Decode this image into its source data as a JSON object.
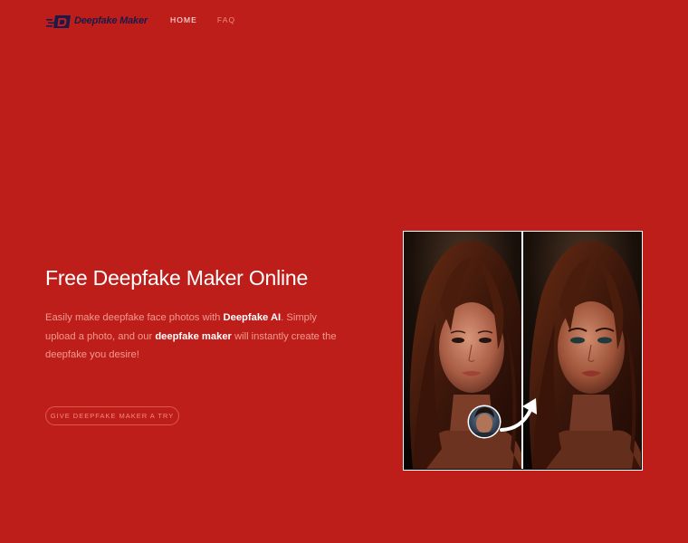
{
  "header": {
    "logo_text": "Deepfake Maker",
    "logo_icon": "deepfake-logo-icon",
    "nav": [
      {
        "label": "HOME",
        "active": true
      },
      {
        "label": "FAQ",
        "active": false
      }
    ]
  },
  "hero": {
    "title": "Free Deepfake Maker Online",
    "desc_part1": "Easily make deepfake face photos with ",
    "desc_bold1": "Deepfake AI",
    "desc_part2": ". Simply upload a photo, and our ",
    "desc_bold2": "deepfake maker",
    "desc_part3": " will instantly create the deepfake you desire!",
    "cta_label": "GIVE DEEPFAKE MAKER A TRY"
  },
  "image_panel": {
    "left_image": "original-face-photo",
    "right_image": "deepfake-result-photo",
    "source_face": "source-face-avatar",
    "arrow_icon": "curved-arrow-icon"
  },
  "colors": {
    "background": "#be1e1a",
    "logo_text": "#1c1a4a",
    "muted_text": "#f39a90",
    "button_border": "#e0564c"
  }
}
